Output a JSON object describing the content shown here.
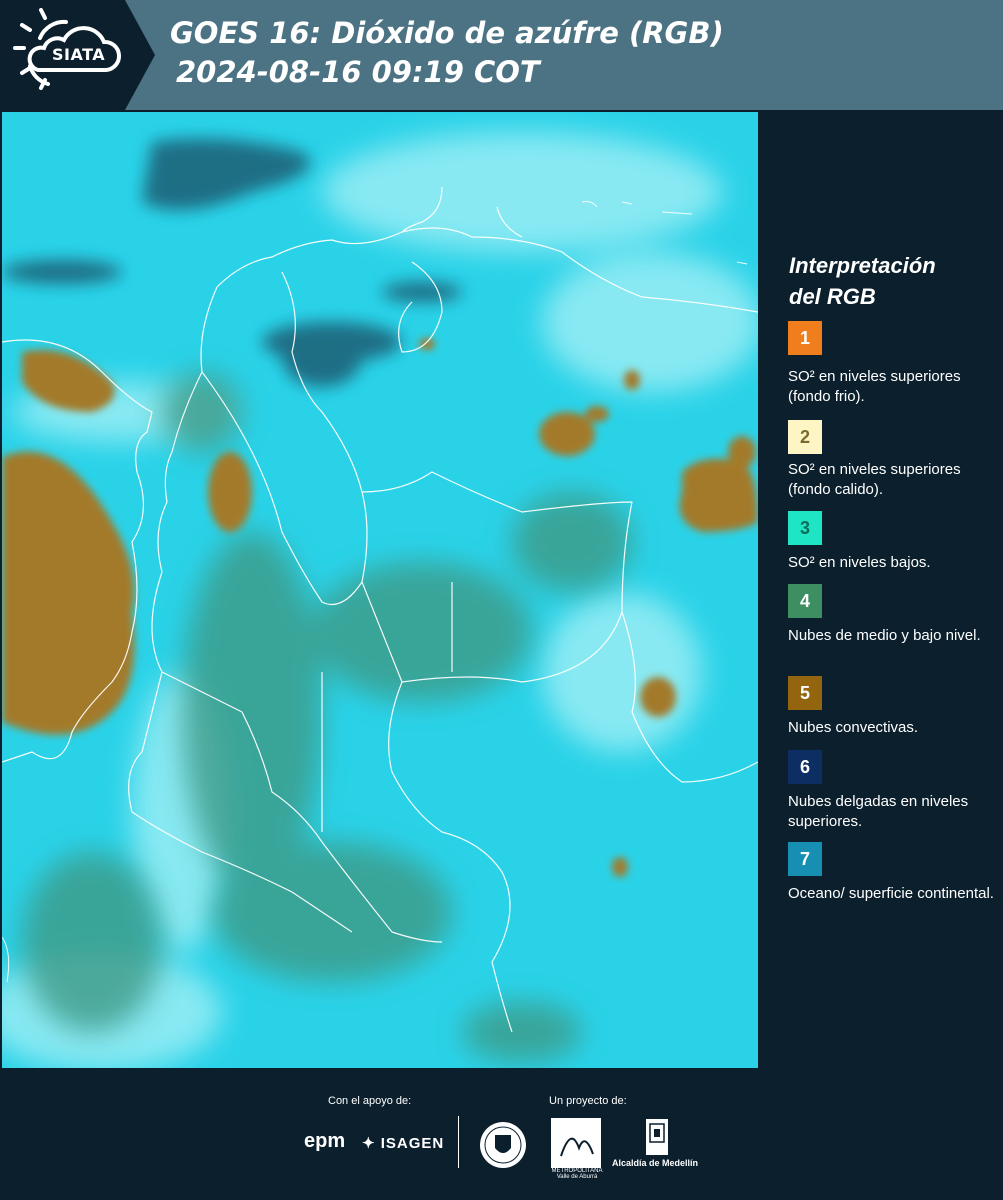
{
  "header": {
    "logo_text": "SIATA",
    "title_line1": "GOES 16: Dióxido de azúfre (RGB)",
    "title_line2": "2024-08-16 09:19 COT"
  },
  "legend": {
    "title_line1": "Interpretación",
    "title_line2": "del RGB",
    "items": [
      {
        "number": "1",
        "color": "#f07e1c",
        "text": "SO² en niveles superiores (fondo frio)."
      },
      {
        "number": "2",
        "color": "#fdf5c4",
        "text": "SO² en niveles superiores (fondo calido)."
      },
      {
        "number": "3",
        "color": "#1ee6c4",
        "text": "SO² en niveles bajos."
      },
      {
        "number": "4",
        "color": "#3d8f62",
        "text": "Nubes de medio y bajo nivel."
      },
      {
        "number": "5",
        "color": "#94650f",
        "text": "Nubes convectivas."
      },
      {
        "number": "6",
        "color": "#0d2e63",
        "text": "Nubes delgadas en niveles superiores."
      },
      {
        "number": "7",
        "color": "#168fb2",
        "text": "Oceano/ superficie continental."
      }
    ]
  },
  "footer": {
    "support_label": "Con el apoyo de:",
    "project_label": "Un proyecto de:",
    "sponsor1": "epm",
    "sponsor2": "ISAGEN",
    "partner1_caption": "METROPOLITANA Valle de Aburrá",
    "partner2_caption": "Alcaldía de Medellín"
  },
  "map": {
    "ocean_color": "#2ad2e8",
    "convective_color": "#a37a2a",
    "low_cloud_color": "#3e9a86"
  }
}
